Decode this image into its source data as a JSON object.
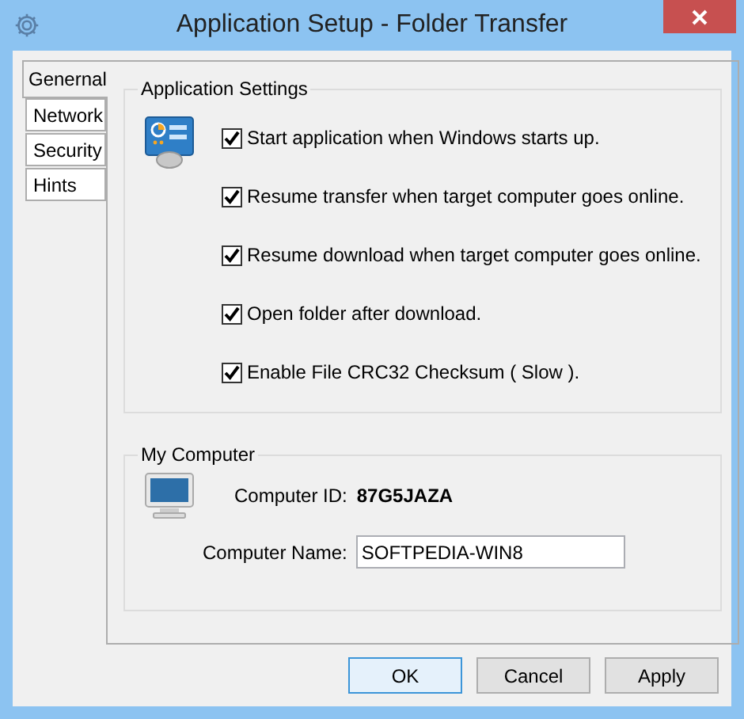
{
  "window": {
    "title": "Application Setup - Folder Transfer"
  },
  "tabs": [
    {
      "label": "Genernal",
      "selected": true
    },
    {
      "label": "Network",
      "selected": false
    },
    {
      "label": "Security",
      "selected": false
    },
    {
      "label": "Hints",
      "selected": false
    }
  ],
  "application_settings": {
    "title": "Application Settings",
    "options": [
      {
        "label": "Start application when Windows starts up.",
        "checked": true
      },
      {
        "label": "Resume transfer when target computer goes online.",
        "checked": true
      },
      {
        "label": "Resume download when target computer goes online.",
        "checked": true
      },
      {
        "label": "Open folder after download.",
        "checked": true
      },
      {
        "label": "Enable File CRC32 Checksum ( Slow ).",
        "checked": true
      }
    ]
  },
  "my_computer": {
    "title": "My Computer",
    "id_label": "Computer ID:",
    "id_value": "87G5JAZA",
    "name_label": "Computer Name:",
    "name_value": "SOFTPEDIA-WIN8"
  },
  "buttons": [
    {
      "label": "OK",
      "default": true
    },
    {
      "label": "Cancel",
      "default": false
    },
    {
      "label": "Apply",
      "default": false
    }
  ]
}
